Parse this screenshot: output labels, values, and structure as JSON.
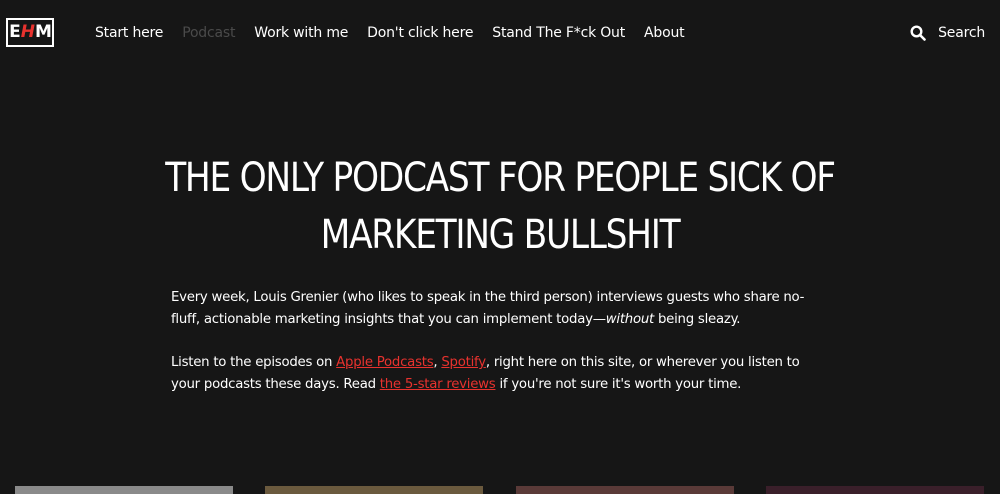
{
  "header": {
    "logo": {
      "left": "E",
      "middle": "H",
      "right": "M"
    },
    "nav": [
      {
        "label": "Start here",
        "active": false
      },
      {
        "label": "Podcast",
        "active": true
      },
      {
        "label": "Work with me",
        "active": false
      },
      {
        "label": "Don't click here",
        "active": false
      },
      {
        "label": "Stand The F*ck Out",
        "active": false
      },
      {
        "label": "About",
        "active": false
      }
    ],
    "search_label": "Search",
    "search_icon": "search-icon"
  },
  "hero": {
    "title_line1": "THE ONLY PODCAST FOR PEOPLE SICK OF",
    "title_line2": "MARKETING BULLSHIT"
  },
  "intro": {
    "text_before": "Every week, Louis Grenier (who likes to speak in the third person) interviews guests who share no-fluff, actionable marketing insights that you can implement today—",
    "emphasis": "without",
    "text_after": " being sleazy."
  },
  "listen": {
    "prefix": "Listen to the episodes on ",
    "apple_link": "Apple Podcasts",
    "comma": ", ",
    "spotify_link": "Spotify",
    "middle": ", right here on this site, or wherever you listen to your podcasts these days. Read ",
    "reviews_link": "the 5-star reviews",
    "suffix": " if you're not sure it's worth your time."
  },
  "colors": {
    "background": "#161616",
    "accent": "#e8322e",
    "text": "#ffffff",
    "nav_active": "#4a4a4a"
  },
  "cards": [
    {
      "name": "episode-card-1",
      "color": "#8a8a8a"
    },
    {
      "name": "episode-card-2",
      "color": "#6b5a3e"
    },
    {
      "name": "episode-card-3",
      "color": "#5a3a38"
    },
    {
      "name": "episode-card-4",
      "color": "#3a1f2a"
    }
  ]
}
